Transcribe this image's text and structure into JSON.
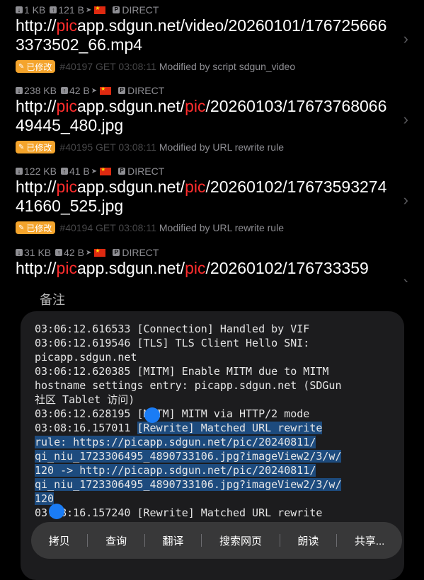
{
  "requests": [
    {
      "down": "1 KB",
      "up": "121 B",
      "policy": "DIRECT",
      "url_prefix": "http://",
      "url_red": "pic",
      "url_host_rest": "app.sdgun.net/",
      "url_path_red": "",
      "url_tail": "video/20260101/1767256663373502_66.mp4",
      "badge": "已修改",
      "id_time": "#40197 GET 03:08:11",
      "desc": "Modified by script sdgun_video"
    },
    {
      "down": "238 KB",
      "up": "42 B",
      "policy": "DIRECT",
      "url_prefix": "http://",
      "url_red": "pic",
      "url_host_rest": "app.sdgun.net/",
      "url_path_red": "pic",
      "url_tail": "/20260103/1767376806649445_480.jpg",
      "badge": "已修改",
      "id_time": "#40195 GET 03:08:11",
      "desc": "Modified by URL rewrite rule"
    },
    {
      "down": "122 KB",
      "up": "41 B",
      "policy": "DIRECT",
      "url_prefix": "http://",
      "url_red": "pic",
      "url_host_rest": "app.sdgun.net/",
      "url_path_red": "pic",
      "url_tail": "/20260102/1767359327441660_525.jpg",
      "badge": "已修改",
      "id_time": "#40194 GET 03:08:11",
      "desc": "Modified by URL rewrite rule"
    },
    {
      "down": "31 KB",
      "up": "42 B",
      "policy": "DIRECT",
      "url_prefix": "http://",
      "url_red": "pic",
      "url_host_rest": "app.sdgun.net/",
      "url_path_red": "pic",
      "url_tail": "/20260102/176733359",
      "badge": "",
      "id_time": "",
      "desc": ""
    }
  ],
  "notes_label": "备注",
  "log": {
    "l1": "03:06:12.616533 [Connection] Handled by VIF",
    "l2": "03:06:12.619546 [TLS] TLS Client Hello SNI:",
    "l3": "picapp.sdgun.net",
    "l4": "03:06:12.620385 [MITM] Enable MITM due to MITM",
    "l5": "hostname settings entry: picapp.sdgun.net (SDGun",
    "l6": "社区 Tablet 访问)",
    "l7": "03:06:12.628195 [MITM] MITM via HTTP/2 mode",
    "l8a": "03:08:16.157011 ",
    "l8b": "[Rewrite] Matched URL rewrite",
    "l9": "rule: https://picapp.sdgun.net/pic/20240811/",
    "l10": "qi_niu_1723306495_4890733106.jpg?imageView2/3/w/",
    "l11": "120 -> http://picapp.sdgun.net/pic/20240811/",
    "l12": "qi_niu_1723306495_4890733106.jpg?imageView2/3/w/",
    "l13": "120",
    "l14": "03:08:16.157240 [Rewrite] Matched URL rewrite"
  },
  "menu": [
    "拷贝",
    "查询",
    "翻译",
    "搜索网页",
    "朗读",
    "共享..."
  ],
  "colors": {
    "badge": "#f4a42c",
    "highlight": "#1d4b7e",
    "handle": "#1a7cf5",
    "url_red": "#ff2d2d"
  }
}
